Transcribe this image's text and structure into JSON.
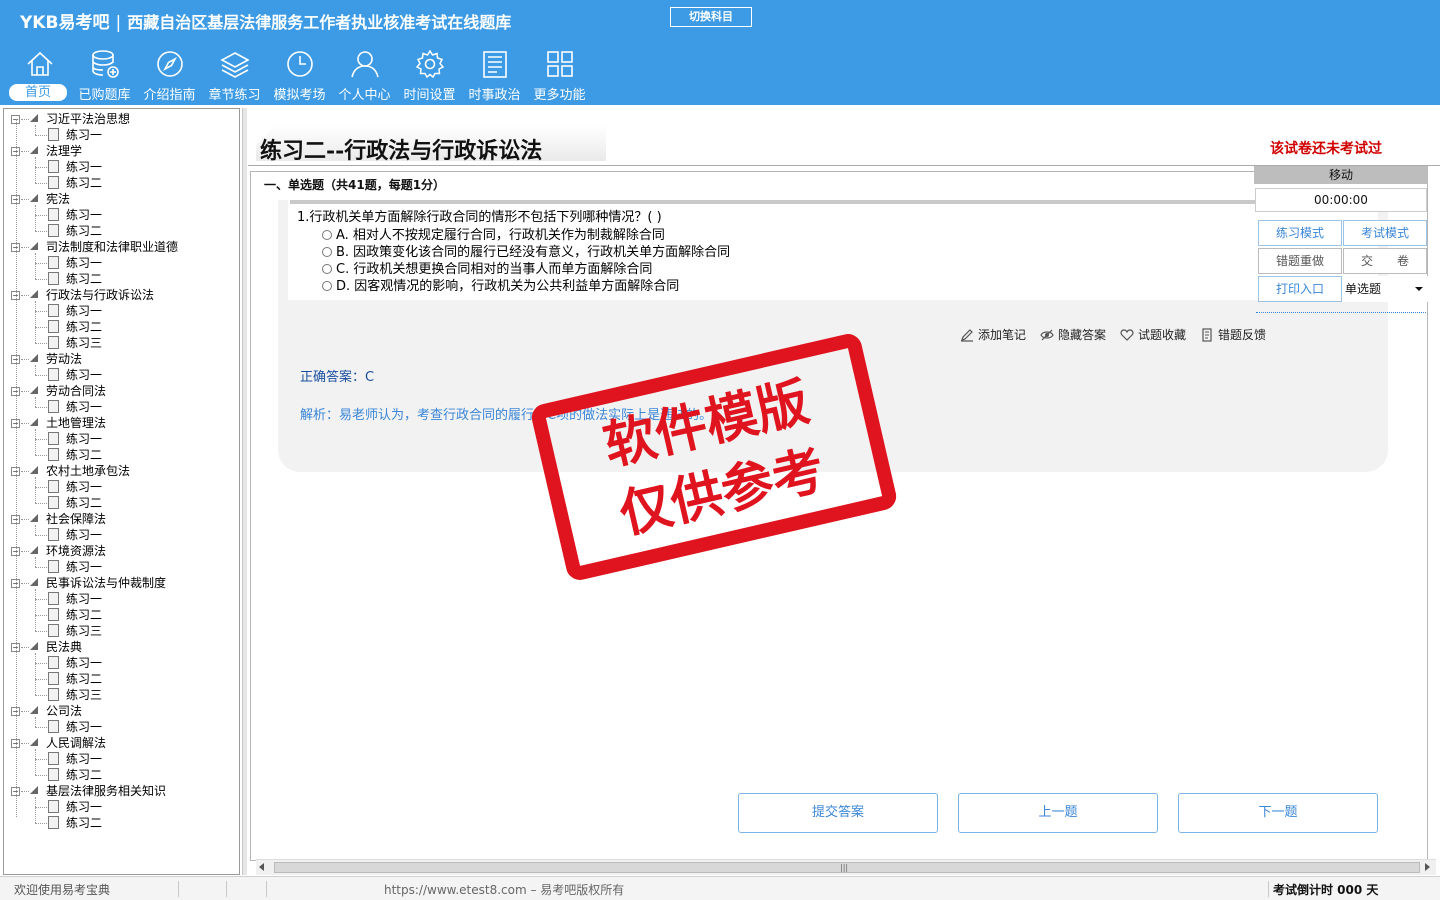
{
  "header": {
    "brand": "YKB易考吧",
    "subtitle": "西藏自治区基层法律服务工作者执业核准考试在线题库",
    "switch_label": "切换科目",
    "nav": [
      {
        "label": "首页",
        "icon": "home-icon"
      },
      {
        "label": "已购题库",
        "icon": "database-add-icon"
      },
      {
        "label": "介绍指南",
        "icon": "compass-icon"
      },
      {
        "label": "章节练习",
        "icon": "layers-icon"
      },
      {
        "label": "模拟考场",
        "icon": "clock-icon"
      },
      {
        "label": "个人中心",
        "icon": "user-icon"
      },
      {
        "label": "时间设置",
        "icon": "gear-icon"
      },
      {
        "label": "时事政治",
        "icon": "newspaper-icon"
      },
      {
        "label": "更多功能",
        "icon": "grid-icon"
      }
    ]
  },
  "tree": [
    {
      "label": "习近平法治思想",
      "children": [
        "练习一"
      ]
    },
    {
      "label": "法理学",
      "children": [
        "练习一",
        "练习二"
      ]
    },
    {
      "label": "宪法",
      "children": [
        "练习一",
        "练习二"
      ]
    },
    {
      "label": "司法制度和法律职业道德",
      "children": [
        "练习一",
        "练习二"
      ]
    },
    {
      "label": "行政法与行政诉讼法",
      "children": [
        "练习一",
        "练习二",
        "练习三"
      ]
    },
    {
      "label": "劳动法",
      "children": [
        "练习一"
      ]
    },
    {
      "label": "劳动合同法",
      "children": [
        "练习一"
      ]
    },
    {
      "label": "土地管理法",
      "children": [
        "练习一",
        "练习二"
      ]
    },
    {
      "label": "农村土地承包法",
      "children": [
        "练习一",
        "练习二"
      ]
    },
    {
      "label": "社会保障法",
      "children": [
        "练习一"
      ]
    },
    {
      "label": "环境资源法",
      "children": [
        "练习一"
      ]
    },
    {
      "label": "民事诉讼法与仲裁制度",
      "children": [
        "练习一",
        "练习二",
        "练习三"
      ]
    },
    {
      "label": "民法典",
      "children": [
        "练习一",
        "练习二",
        "练习三"
      ]
    },
    {
      "label": "公司法",
      "children": [
        "练习一"
      ]
    },
    {
      "label": "人民调解法",
      "children": [
        "练习一",
        "练习二"
      ]
    },
    {
      "label": "基层法律服务相关知识",
      "children": [
        "练习一",
        "练习二"
      ]
    }
  ],
  "main": {
    "paper_title": "练习二--行政法与行政诉讼法",
    "status_note": "该试卷还未考试过",
    "section_heading": "一、单选题（共41题，每题1分）",
    "question": "1.行政机关单方面解除行政合同的情形不包括下列哪种情况？( )",
    "options": [
      "A. 相对人不按规定履行合同，行政机关作为制裁解除合同",
      "B. 因政策变化该合同的履行已经没有意义，行政机关单方面解除合同",
      "C. 行政机关想更换合同相对的当事人而单方面解除合同",
      "D. 因客观情况的影响，行政机关为公共利益单方面解除合同"
    ],
    "tools": [
      "添加笔记",
      "隐藏答案",
      "试题收藏",
      "错题反馈"
    ],
    "answer": "正确答案：C",
    "analysis": "解析：易老师认为，考查行政合同的履行。C项的做法实际上是违法的。",
    "watermark_line1": "软件模版",
    "watermark_line2": "仅供参考",
    "buttons": {
      "submit": "提交答案",
      "prev": "上一题",
      "next": "下一题"
    }
  },
  "panel": {
    "move_label": "移动",
    "timer": "00:00:00",
    "practice_mode": "练习模式",
    "exam_mode": "考试模式",
    "wrong_redo": "错题重做",
    "hand_in": "交　　卷",
    "print": "打印入口",
    "type_select": "单选题"
  },
  "status": {
    "welcome": "欢迎使用易考宝典",
    "copyright": "https://www.etest8.com – 易考吧版权所有",
    "countdown": "考试倒计时 000 天"
  },
  "colors": {
    "header": "#3d9be6",
    "accent": "#3a86d8",
    "warning": "#d00000",
    "stamp": "#e0141e"
  }
}
